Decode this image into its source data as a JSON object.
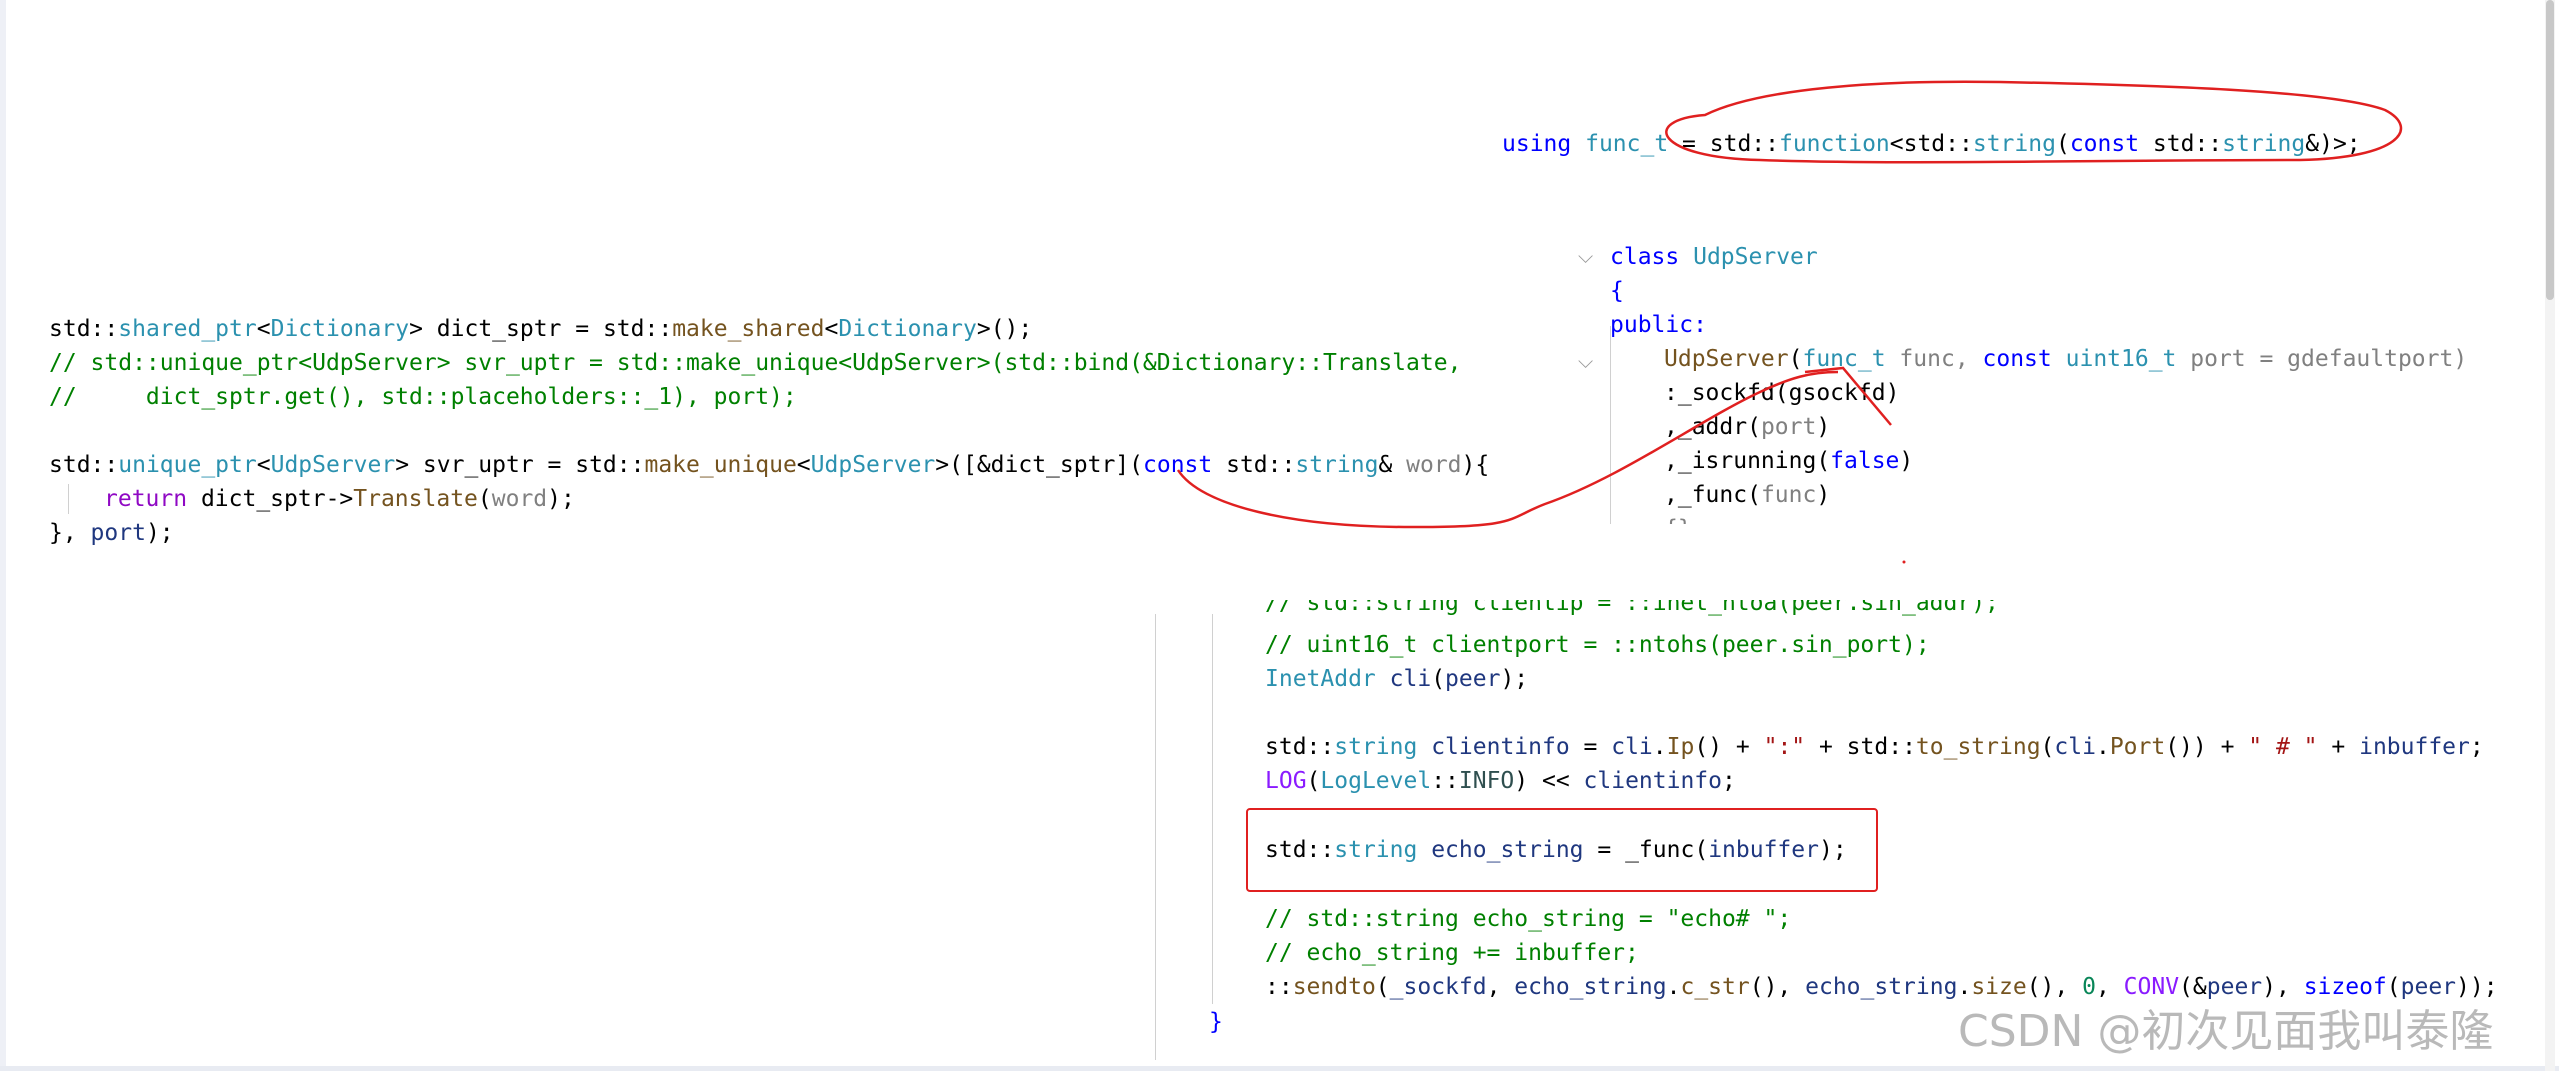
{
  "code_panels": {
    "using_line": {
      "keyword": "using",
      "alias": "func_t",
      "rest": " = std::function<std::string(const std::string&)>;",
      "rest_parts": [
        " = std::",
        "function",
        "<std::",
        "string",
        "(",
        "const",
        " std::",
        "string",
        "&)>;"
      ]
    },
    "class_decl": {
      "line1": [
        "class",
        " ",
        "UdpServer"
      ],
      "line2": "{",
      "line3": "public:",
      "line4": [
        "UdpServer",
        "(",
        "func_t",
        " func, ",
        "const",
        " ",
        "uint16_t",
        " port = gdefaultport)"
      ],
      "line5": [
        ":_sockfd(",
        "gsockfd",
        ")"
      ],
      "line6": [
        ",_addr(",
        "port",
        ")"
      ],
      "line7": [
        ",_isrunning(",
        "false",
        ")"
      ],
      "line8": [
        ",_func(",
        "func",
        ")"
      ],
      "line9": "{}"
    },
    "main_code": {
      "line1": [
        "std::",
        "shared_ptr",
        "<",
        "Dictionary",
        "> dict_sptr = std::",
        "make_shared",
        "<",
        "Dictionary",
        ">();"
      ],
      "line2": "// std::unique_ptr<UdpServer> svr_uptr = std::make_unique<UdpServer>(std::bind(&Dictionary::Translate,",
      "line3": "//     dict_sptr.get(), std::placeholders::_1), port);",
      "line4": [
        "std::",
        "unique_ptr",
        "<",
        "UdpServer",
        "> svr_uptr = std::",
        "make_unique",
        "<",
        "UdpServer",
        ">([&dict_sptr](",
        "const",
        " std::",
        "string",
        "& ",
        "word",
        "){"
      ],
      "line5": [
        "return",
        " dict_sptr->",
        "Translate",
        "(",
        "word",
        ");"
      ],
      "line6": [
        "}, ",
        "port",
        ");"
      ]
    },
    "recv_code": {
      "line0": "// std::string clientip = ::inet_ntoa(peer.sin_addr);",
      "line1": "// uint16_t clientport = ::ntohs(peer.sin_port);",
      "line2": [
        "InetAddr",
        " ",
        "cli",
        "(",
        "peer",
        ");"
      ],
      "line3": [
        "std::",
        "string",
        " ",
        "clientinfo",
        " = ",
        "cli",
        ".",
        "Ip",
        "() + ",
        "\":\"",
        " + std::",
        "to_string",
        "(",
        "cli",
        ".",
        "Port",
        "()) + ",
        "\" # \"",
        " + ",
        "inbuffer",
        ";"
      ],
      "line4": [
        "LOG",
        "(",
        "LogLevel",
        "::",
        "INFO",
        ") << ",
        "clientinfo",
        ";"
      ],
      "line5": [
        "std::",
        "string",
        " ",
        "echo_string",
        " = ",
        "_func",
        "(",
        "inbuffer",
        ");"
      ],
      "line6": "// std::string echo_string = \"echo# \";",
      "line7": "// echo_string += inbuffer;",
      "line8": [
        "::",
        "sendto",
        "(",
        "_sockfd",
        ", ",
        "echo_string",
        ".",
        "c_str",
        "(), ",
        "echo_string",
        ".",
        "size",
        "(), ",
        "0",
        ", ",
        "CONV",
        "(&",
        "peer",
        "), ",
        "sizeof",
        "(",
        "peer",
        "));"
      ],
      "line9": "}"
    }
  },
  "watermark": "CSDN @初次见面我叫泰隆",
  "colors": {
    "annotation_red": "#e02020",
    "keyword": "#0000ff",
    "type": "#2b91af",
    "comment": "#008000",
    "string": "#a31515"
  }
}
